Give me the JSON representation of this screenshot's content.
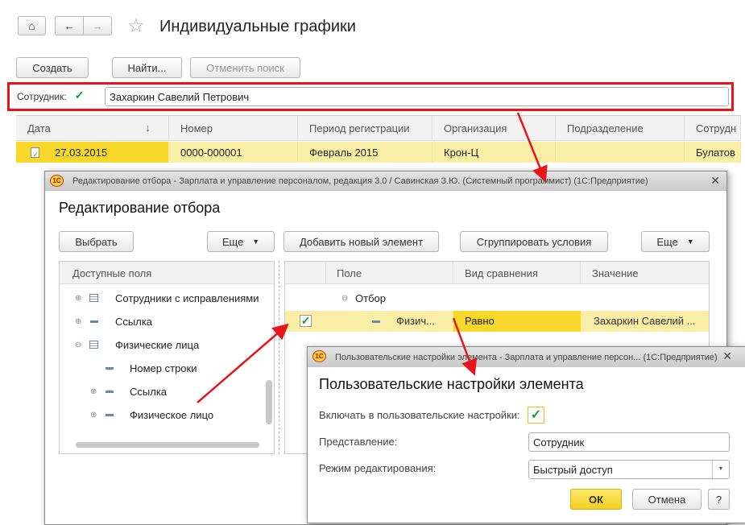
{
  "main": {
    "title": "Индивидуальные графики",
    "buttons": {
      "create": "Создать",
      "find": "Найти...",
      "cancel_search": "Отменить поиск"
    },
    "filter": {
      "label": "Сотрудник:",
      "checked": true,
      "value": "Захаркин Савелий Петрович"
    },
    "table": {
      "columns": [
        "Дата",
        "Номер",
        "Период регистрации",
        "Организация",
        "Подразделение",
        "Сотрудн"
      ],
      "sort_icon": "↓",
      "rows": [
        {
          "date": "27.03.2015",
          "number": "0000-000001",
          "period": "Февраль 2015",
          "org": "Крон-Ц",
          "dept": "",
          "employee": "Булатов"
        }
      ]
    }
  },
  "filter_dialog": {
    "titlebar": "Редактирование отбора - Зарплата и управление персоналом, редакция 3.0 / Савинская З.Ю. (Системный программист)  (1С:Предприятие)",
    "logo": "1С",
    "heading": "Редактирование отбора",
    "buttons": {
      "select": "Выбрать",
      "more_left": "Еще",
      "add": "Добавить новый элемент",
      "group": "Сгруппировать условия",
      "more_right": "Еще"
    },
    "fields_header": "Доступные поля",
    "tree": [
      {
        "label": "Сотрудники с исправлениями",
        "expander": "⊕"
      },
      {
        "label": "Ссылка",
        "expander": "⊕"
      },
      {
        "label": "Физические лица",
        "expander": "⊖"
      },
      {
        "label": "Номер строки",
        "expander": ""
      },
      {
        "label": "Ссылка",
        "expander": "⊕"
      },
      {
        "label": "Физическое лицо",
        "expander": "⊕"
      }
    ],
    "columns": [
      "Поле",
      "Вид сравнения",
      "Значение"
    ],
    "group_row": "Отбор",
    "condition": {
      "checked": true,
      "field": "Физич...",
      "comparison": "Равно",
      "value": "Захаркин Савелий ..."
    }
  },
  "settings_dialog": {
    "titlebar": "Пользовательские настройки элемента - Зарплата и управление персон...  (1С:Предприятие)",
    "logo": "1С",
    "heading": "Пользовательские настройки элемента",
    "include_label": "Включать в пользовательские настройки:",
    "include_checked": true,
    "presentation_label": "Представление:",
    "presentation_value": "Сотрудник",
    "mode_label": "Режим редактирования:",
    "mode_value": "Быстрый доступ",
    "ok": "ОК",
    "cancel": "Отмена",
    "help": "?"
  }
}
